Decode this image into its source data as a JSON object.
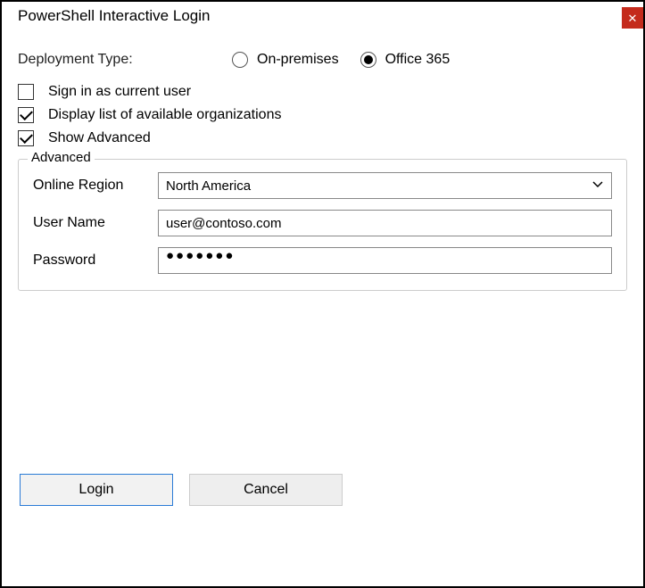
{
  "window": {
    "title": "PowerShell Interactive Login"
  },
  "deployment": {
    "label": "Deployment Type:",
    "options": {
      "onprem": "On-premises",
      "office365": "Office 365"
    },
    "selected": "office365"
  },
  "checkboxes": {
    "current_user": {
      "label": "Sign in as current user",
      "checked": false
    },
    "list_orgs": {
      "label": "Display list of available organizations",
      "checked": true
    },
    "show_advanced": {
      "label": "Show Advanced",
      "checked": true
    }
  },
  "advanced": {
    "legend": "Advanced",
    "region_label": "Online Region",
    "region_value": "North America",
    "username_label": "User Name",
    "username_value": "user@contoso.com",
    "password_label": "Password",
    "password_masked": "●●●●●●●"
  },
  "buttons": {
    "login": "Login",
    "cancel": "Cancel"
  }
}
